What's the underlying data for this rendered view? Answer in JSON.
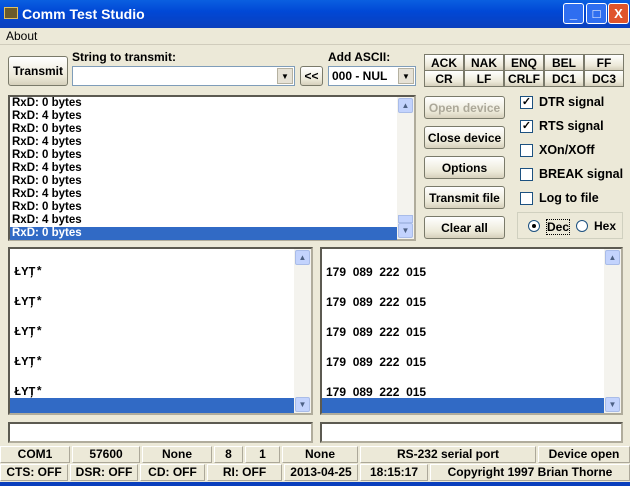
{
  "window": {
    "title": "Comm Test Studio",
    "minimize": "_",
    "maximize": "□",
    "close": "X"
  },
  "menu": {
    "items": [
      "About"
    ]
  },
  "toolbar": {
    "transmit_label": "Transmit",
    "string_label": "String to transmit:",
    "string_value": "",
    "insert_label": "<<",
    "ascii_label": "Add ASCII:",
    "ascii_value": "000 - NUL",
    "ascii_buttons": [
      [
        "ACK",
        "NAK",
        "ENQ",
        "BEL",
        "FF"
      ],
      [
        "CR",
        "LF",
        "CRLF",
        "DC1",
        "DC3"
      ]
    ]
  },
  "log": {
    "rows": [
      "RxD: 0 bytes",
      "RxD: 4 bytes",
      "RxD: 0 bytes",
      "RxD: 4 bytes",
      "RxD: 0 bytes",
      "RxD: 4 bytes",
      "RxD: 0 bytes",
      "RxD: 4 bytes",
      "RxD: 0 bytes",
      "RxD: 4 bytes",
      "RxD: 0 bytes"
    ],
    "selected_index": 10
  },
  "actions": {
    "open": "Open device",
    "close": "Close device",
    "options": "Options",
    "transmit_file": "Transmit file",
    "clear": "Clear all"
  },
  "options": {
    "dtr": {
      "label": "DTR signal",
      "checked": true
    },
    "rts": {
      "label": "RTS signal",
      "checked": true
    },
    "xon": {
      "label": "XOn/XOff",
      "checked": false
    },
    "brk": {
      "label": "BREAK signal",
      "checked": false
    },
    "log": {
      "label": "Log to file",
      "checked": false
    },
    "dec": "Dec",
    "hex": "Hex",
    "format": "Dec"
  },
  "text_pane": {
    "lines": [
      "ŁYŢ*",
      "ŁYŢ*",
      "ŁYŢ*",
      "ŁYŢ*",
      "ŁYŢ*"
    ]
  },
  "dec_pane": {
    "lines": [
      "179  089  222  015",
      "179  089  222  015",
      "179  089  222  015",
      "179  089  222  015",
      "179  089  222  015"
    ]
  },
  "status1": [
    "COM1",
    "57600",
    "None",
    "8",
    "1",
    "None",
    "RS-232 serial port",
    "Device open"
  ],
  "status2": [
    "CTS: OFF",
    "DSR: OFF",
    "CD: OFF",
    "RI: OFF",
    "2013-04-25",
    "18:15:17",
    "Copyright 1997 Brian Thorne"
  ]
}
